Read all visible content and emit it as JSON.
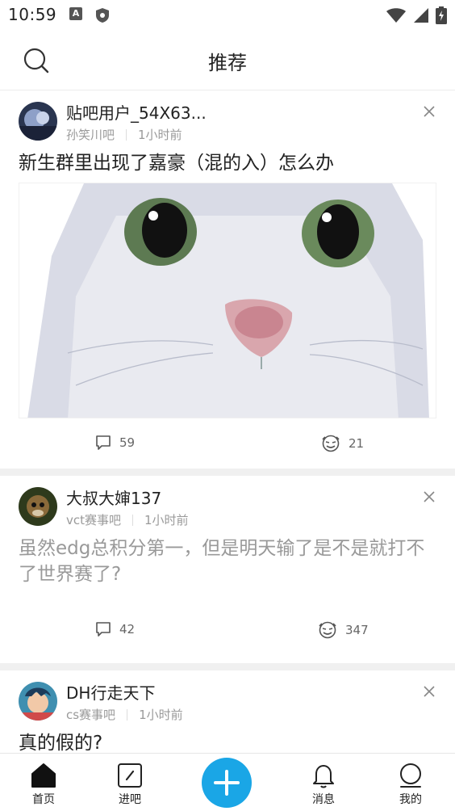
{
  "status_bar": {
    "time": "10:59",
    "icons": [
      "a-notification-icon",
      "shield-icon",
      "wifi-icon",
      "signal-icon",
      "battery-charging-icon"
    ]
  },
  "header": {
    "title": "推荐",
    "search_icon": "search-icon"
  },
  "feed": {
    "posts": [
      {
        "author": "贴吧用户_54X63...",
        "forum": "孙笑川吧",
        "time": "1小时前",
        "title": "新生群里出现了嘉豪（混的入）怎么办",
        "has_image": true,
        "comments": "59",
        "likes": "21"
      },
      {
        "author": "大叔大婶137",
        "forum": "vct赛事吧",
        "time": "1小时前",
        "title": "虽然edg总积分第一，但是明天输了是不是就打不了世界赛了?",
        "has_image": false,
        "comments": "42",
        "likes": "347"
      },
      {
        "author": "DH行走天下",
        "forum": "cs赛事吧",
        "time": "1小时前",
        "title": "真的假的?",
        "has_image": false
      }
    ]
  },
  "bottom_nav": {
    "items": [
      {
        "label": "首页",
        "icon": "home-icon"
      },
      {
        "label": "进吧",
        "icon": "forum-icon"
      },
      {
        "label": "",
        "icon": "plus-icon"
      },
      {
        "label": "消息",
        "icon": "bell-icon"
      },
      {
        "label": "我的",
        "icon": "profile-icon"
      }
    ]
  },
  "colors": {
    "accent": "#1aa6e6",
    "text": "#222222",
    "muted": "#9a9a9a",
    "separator": "#f0f0f0"
  }
}
